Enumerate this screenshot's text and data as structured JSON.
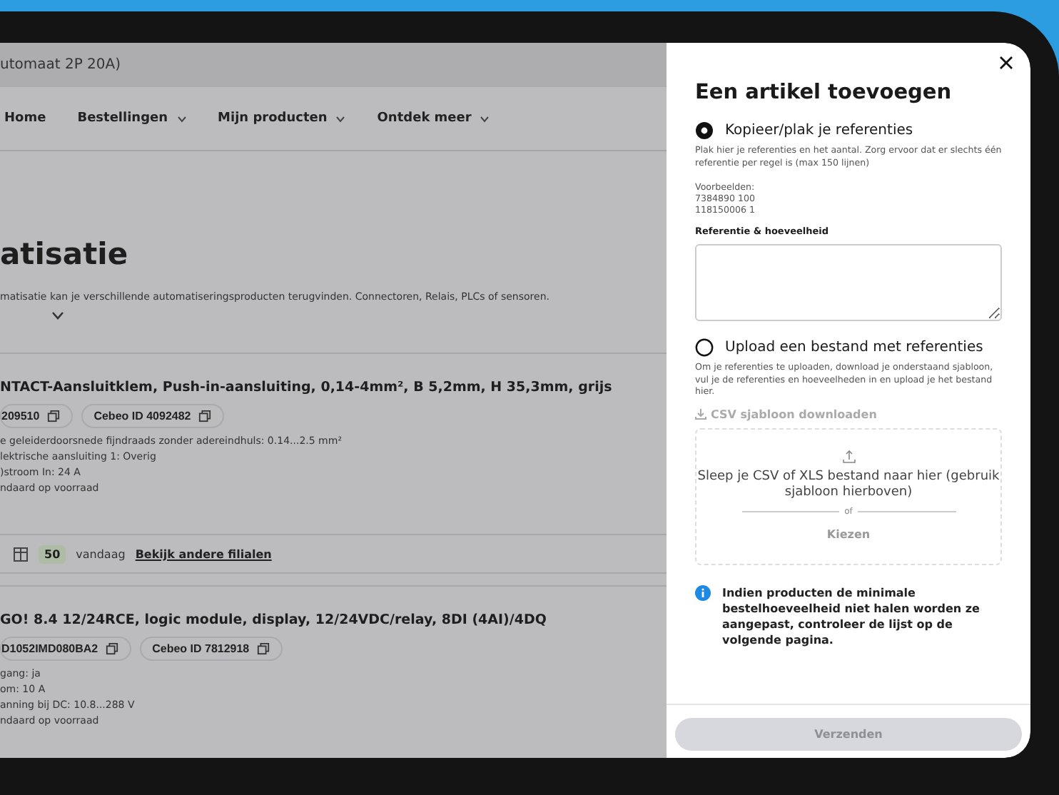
{
  "page": {
    "breadcrumb": "utomaat 2P 20A)",
    "nav": [
      {
        "label": "Home",
        "dropdown": false
      },
      {
        "label": "Bestellingen",
        "dropdown": true
      },
      {
        "label": "Mijn producten",
        "dropdown": true
      },
      {
        "label": "Ontdek meer",
        "dropdown": true
      }
    ],
    "heading": "atisatie",
    "description": "matisatie kan je verschillende automatiseringsproducten terugvinden. Connectoren, Relais, PLCs of sensoren.",
    "products": [
      {
        "title": "NTACT-Aansluitklem, Push-in-aansluiting, 0,14-4mm², B 5,2mm, H 35,3mm, grijs",
        "chips": [
          "209510",
          "Cebeo ID 4092482"
        ],
        "specs": [
          "e geleiderdoorsnede fijndraads zonder adereindhuls: 0.14...2.5 mm²",
          "lektrische aansluiting 1: Overig",
          ")stroom In: 24 A",
          "ndaard op voorraad"
        ],
        "stock": {
          "count": "50",
          "when": "vandaag",
          "link": "Bekijk andere filialen"
        }
      },
      {
        "title": "GO! 8.4 12/24RCE, logic module, display, 12/24VDC/relay, 8DI (4AI)/4DQ",
        "chips": [
          "D1052IMD080BA2",
          "Cebeo ID 7812918"
        ],
        "specs": [
          "gang: ja",
          "om: 10 A",
          "anning bij DC: 10.8...288 V",
          "ndaard op voorraad"
        ]
      }
    ]
  },
  "modal": {
    "title": "Een artikel toevoegen",
    "copy_option": {
      "label": "Kopieer/plak je referenties",
      "selected": true,
      "hint": "Plak hier je referenties en het aantal. Zorg ervoor dat er slechts één referentie per regel is (max 150 lijnen)",
      "examples_label": "Voorbeelden:",
      "examples": [
        "7384890 100",
        "118150006 1"
      ],
      "field_label": "Referentie & hoeveelheid"
    },
    "upload_option": {
      "label": "Upload een bestand met referenties",
      "selected": false,
      "hint": "Om je referenties te uploaden, download je onderstaand sjabloon, vul je de referenties en hoeveelheden in en upload je het bestand hier.",
      "download_link": "CSV sjabloon downloaden",
      "dropzone_text": "Sleep je CSV of XLS bestand naar hier (gebruik sjabloon hierboven)",
      "separator": "of",
      "choose": "Kiezen"
    },
    "info": "Indien producten de minimale bestelhoeveelheid niet halen worden ze aangepast, controleer de lijst op de volgende pagina.",
    "submit": {
      "label": "Verzenden",
      "disabled": true
    }
  }
}
